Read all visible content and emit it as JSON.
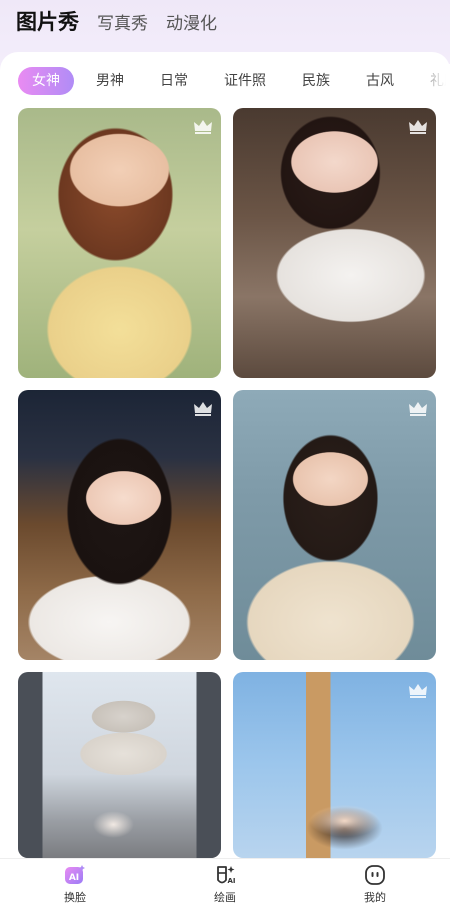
{
  "top_tabs": [
    {
      "label": "图片秀",
      "active": true
    },
    {
      "label": "写真秀",
      "active": false
    },
    {
      "label": "动漫化",
      "active": false
    }
  ],
  "categories": [
    {
      "label": "女神",
      "active": true
    },
    {
      "label": "男神",
      "active": false
    },
    {
      "label": "日常",
      "active": false
    },
    {
      "label": "证件照",
      "active": false
    },
    {
      "label": "民族",
      "active": false
    },
    {
      "label": "古风",
      "active": false
    },
    {
      "label": "礼服",
      "active": false
    }
  ],
  "cards": [
    {
      "scene": "woman-with-braids-and-flowers",
      "badge": "crown-icon"
    },
    {
      "scene": "woman-in-school-uniform",
      "badge": "crown-icon"
    },
    {
      "scene": "woman-at-night-city",
      "badge": "crown-icon"
    },
    {
      "scene": "woman-by-the-sea",
      "badge": "crown-icon"
    },
    {
      "scene": "woman-in-front-of-cathedral",
      "badge": "none"
    },
    {
      "scene": "woman-in-front-of-clock-tower",
      "badge": "crown-icon"
    }
  ],
  "bottom_nav": [
    {
      "label": "换脸",
      "icon": "ai-face-icon",
      "active": true
    },
    {
      "label": "绘画",
      "icon": "ai-paint-icon",
      "active": false
    },
    {
      "label": "我的",
      "icon": "profile-icon",
      "active": false
    }
  ],
  "colors": {
    "accent_start": "#e98bf2",
    "accent_end": "#b08cf6"
  }
}
